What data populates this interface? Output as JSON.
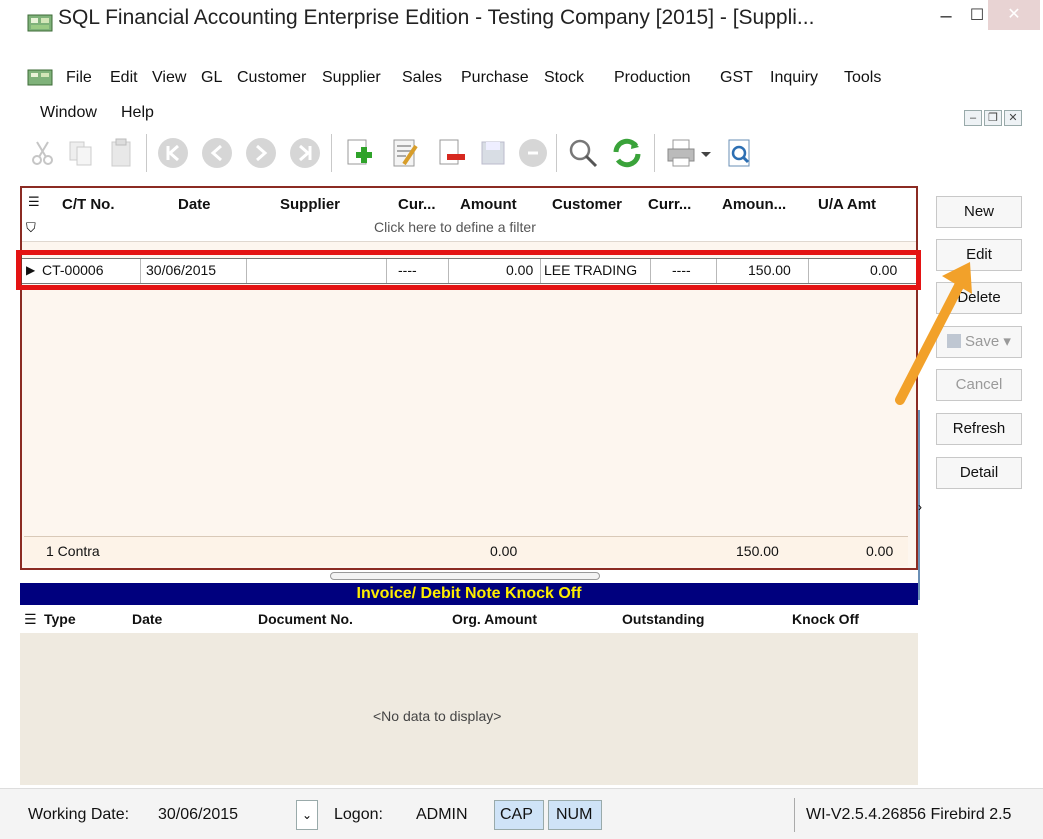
{
  "window": {
    "title": "SQL Financial Accounting Enterprise Edition - Testing Company [2015] - [Suppli...",
    "minimize_glyph": "‒",
    "maximize_glyph": "☐",
    "close_glyph": "✕"
  },
  "menu": {
    "items": [
      {
        "label": "File"
      },
      {
        "label": "Edit"
      },
      {
        "label": "View"
      },
      {
        "label": "GL"
      },
      {
        "label": "Customer"
      },
      {
        "label": "Supplier"
      },
      {
        "label": "Sales"
      },
      {
        "label": "Purchase"
      },
      {
        "label": "Stock"
      },
      {
        "label": "Production"
      },
      {
        "label": "GST"
      },
      {
        "label": "Inquiry"
      },
      {
        "label": "Tools"
      },
      {
        "label": "Window"
      },
      {
        "label": "Help"
      }
    ],
    "mdi_min": "–",
    "mdi_restore": "❐",
    "mdi_close": "✕"
  },
  "grid": {
    "columns": [
      "C/T No.",
      "Date",
      "Supplier",
      "Cur...",
      "Amount",
      "Customer",
      "Curr...",
      "Amoun...",
      "U/A Amt"
    ],
    "filter_hint": "Click here to define a filter",
    "row": {
      "ct_no": "CT-00006",
      "date": "30/06/2015",
      "supplier": "",
      "cur": "----",
      "amount": "0.00",
      "customer": "LEE TRADING",
      "curr2": "----",
      "amount2": "150.00",
      "ua_amt": "0.00"
    },
    "footer": {
      "count": "1 Contra",
      "amount": "0.00",
      "amount2": "150.00",
      "ua_amt": "0.00"
    }
  },
  "side_buttons": {
    "new": "New",
    "edit": "Edit",
    "delete": "Delete",
    "save": "Save",
    "cancel": "Cancel",
    "refresh": "Refresh",
    "detail": "Detail"
  },
  "knockoff": {
    "title": "Invoice/ Debit Note Knock Off",
    "columns": [
      "Type",
      "Date",
      "Document No.",
      "Org. Amount",
      "Outstanding",
      "Knock Off"
    ],
    "empty_text": "<No data to display>"
  },
  "status": {
    "working_date_label": "Working Date:",
    "working_date": "30/06/2015",
    "logon_label": "Logon:",
    "user": "ADMIN",
    "cap": "CAP",
    "num": "NUM",
    "version": "WI-V2.5.4.26856 Firebird 2.5"
  },
  "colors": {
    "accent_red": "#e41313",
    "header_navy": "#00007e",
    "header_yellow": "#ffee00",
    "arrow_orange": "#f2a12a"
  }
}
